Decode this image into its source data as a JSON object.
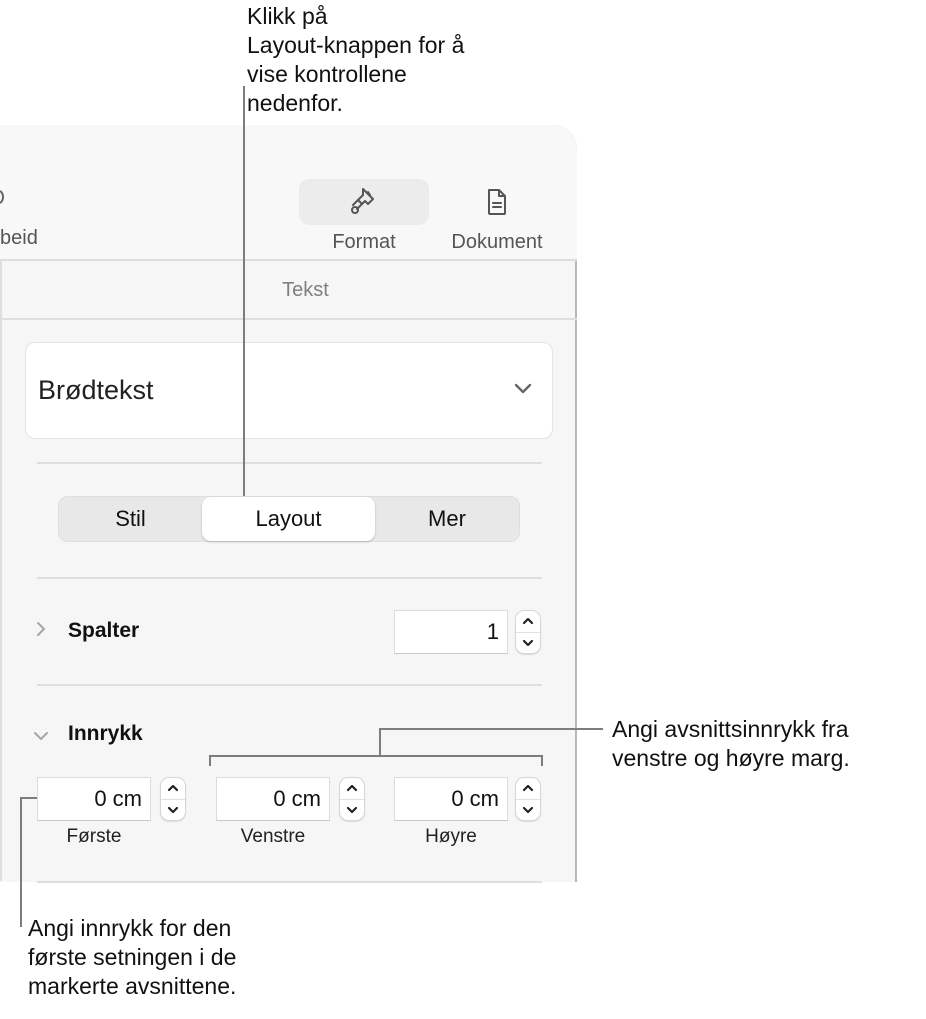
{
  "callouts": {
    "layout_button": "Klikk på\nLayout-knappen for å\nvise kontrollene\nnedenfor.",
    "paragraph_indent": "Angi avsnittsinnrykk fra\nvenstre og høyre marg.",
    "first_line_indent": "Angi innrykk for den\nførste setningen i de\nmarkerte avsnittene."
  },
  "toolbar": {
    "partial_label": "beid",
    "buttons": [
      {
        "label": "Format",
        "icon": "paintbrush-icon",
        "active": true
      },
      {
        "label": "Dokument",
        "icon": "document-icon",
        "active": false
      }
    ]
  },
  "sidebar": {
    "section_title": "Tekst",
    "paragraph_style": {
      "value": "Brødtekst"
    },
    "tabs": [
      {
        "label": "Stil",
        "active": false
      },
      {
        "label": "Layout",
        "active": true
      },
      {
        "label": "Mer",
        "active": false
      }
    ],
    "columns": {
      "label": "Spalter",
      "value": "1",
      "expanded": false
    },
    "indents": {
      "label": "Innrykk",
      "expanded": true,
      "fields": [
        {
          "label": "Første",
          "value": "0 cm"
        },
        {
          "label": "Venstre",
          "value": "0 cm"
        },
        {
          "label": "Høyre",
          "value": "0 cm"
        }
      ]
    }
  },
  "colors": {
    "panel_bg": "#f6f6f6",
    "active_toolbar_bg": "#ececec",
    "leader_line": "#7d7d7d"
  }
}
